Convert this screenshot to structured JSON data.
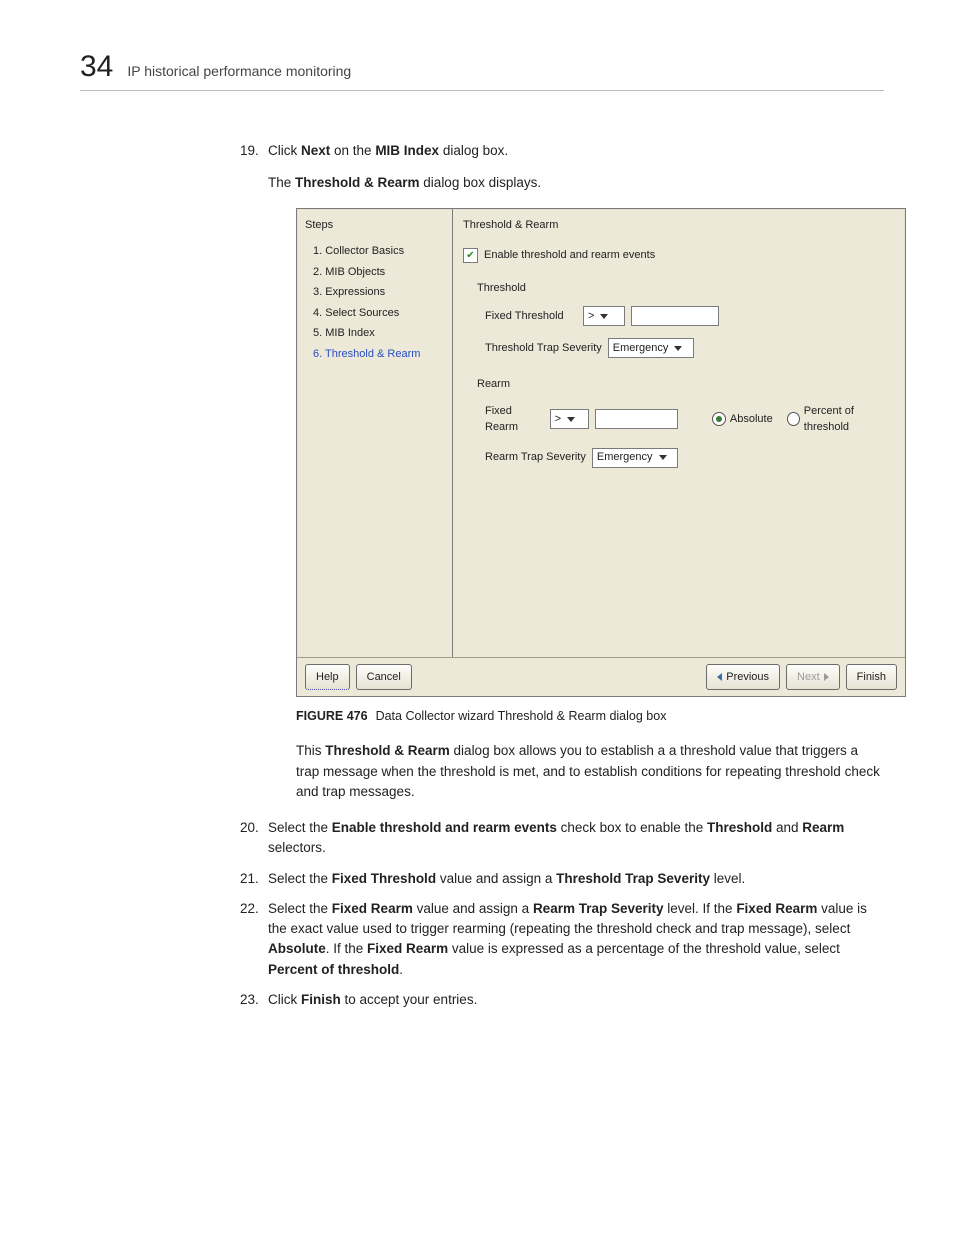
{
  "header": {
    "page_number": "34",
    "title": "IP historical performance monitoring"
  },
  "step19": {
    "num": "19.",
    "t1": "Click ",
    "b1": "Next",
    "t2": " on the ",
    "b2": "MIB Index",
    "t3": " dialog box.",
    "sub_t1": "The ",
    "sub_b1": "Threshold & Rearm",
    "sub_t2": " dialog box displays."
  },
  "dialog": {
    "steps_header": "Steps",
    "step_items": {
      "s1": "1. Collector Basics",
      "s2": "2. MIB Objects",
      "s3": "3. Expressions",
      "s4": "4. Select Sources",
      "s5": "5. MIB Index",
      "s6": "6. Threshold & Rearm"
    },
    "panel_title": "Threshold & Rearm",
    "enable_label": "Enable threshold and rearm events",
    "checkmark": "✔",
    "threshold_section": "Threshold",
    "fixed_threshold_label": "Fixed Threshold",
    "op_gt": ">",
    "threshold_trap_label": "Threshold Trap Severity",
    "emergency": "Emergency",
    "rearm_section": "Rearm",
    "fixed_rearm_label": "Fixed Rearm",
    "rearm_trap_label": "Rearm Trap Severity",
    "radio_absolute": "Absolute",
    "radio_percent": "Percent of threshold",
    "buttons": {
      "help": "Help",
      "cancel": "Cancel",
      "previous": "Previous",
      "next": "Next",
      "finish": "Finish"
    }
  },
  "figure": {
    "num": "FIGURE 476",
    "caption": "Data Collector wizard Threshold & Rearm dialog box"
  },
  "para_after": {
    "t1": "This ",
    "b1": "Threshold & Rearm",
    "t2": " dialog box allows you to establish a a threshold value that triggers a trap message when the threshold is met, and to establish conditions for repeating threshold check and trap messages."
  },
  "step20": {
    "num": "20.",
    "t1": "Select the ",
    "b1": "Enable threshold and rearm events",
    "t2": " check box to enable the ",
    "b2": "Threshold",
    "t3": " and ",
    "b3": "Rearm",
    "t4": " selectors."
  },
  "step21": {
    "num": "21.",
    "t1": "Select the ",
    "b1": "Fixed Threshold",
    "t2": " value and assign a ",
    "b2": "Threshold Trap Severity",
    "t3": " level."
  },
  "step22": {
    "num": "22.",
    "t1": "Select the ",
    "b1": "Fixed Rearm",
    "t2": " value and assign a ",
    "b2": "Rearm Trap Severity",
    "t3": " level. If the ",
    "b3": "Fixed Rearm",
    "t4": " value is the exact value used to trigger rearming (repeating the threshold check and trap message), select ",
    "b4": "Absolute",
    "t5": ". If the ",
    "b5": "Fixed Rearm",
    "t6": " value is expressed as a percentage of the threshold value, select ",
    "b6": "Percent of threshold",
    "t7": "."
  },
  "step23": {
    "num": "23.",
    "t1": "Click ",
    "b1": "Finish",
    "t2": " to accept your entries."
  }
}
